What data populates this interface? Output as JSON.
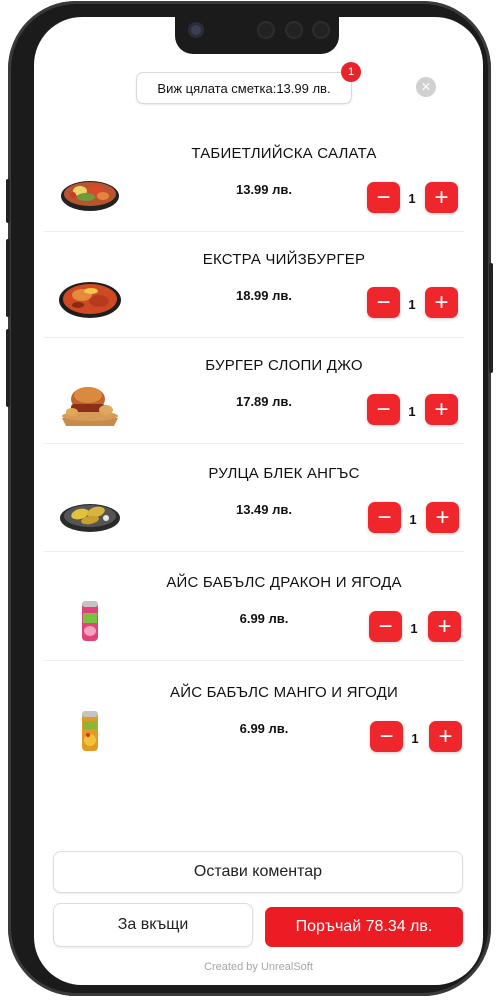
{
  "header": {
    "bill_label": "Виж цялата сметка:13.99 лв.",
    "bill_badge": "1",
    "close_icon": "close-icon"
  },
  "items": [
    {
      "name": "ТАБИЕТЛИЙСКА САЛАТА",
      "price": "13.99 лв.",
      "qty": "1",
      "thumb": "salad"
    },
    {
      "name": "ЕКСТРА ЧИЙЗБУРГЕР",
      "price": "18.99 лв.",
      "qty": "1",
      "thumb": "platter"
    },
    {
      "name": "БУРГЕР СЛОПИ ДЖО",
      "price": "17.89 лв.",
      "qty": "1",
      "thumb": "burger"
    },
    {
      "name": "РУЛЦА БЛЕК АНГЪС",
      "price": "13.49 лв.",
      "qty": "1",
      "thumb": "rolls"
    },
    {
      "name": "АЙС БАБЪЛС ДРАКОН И ЯГОДА",
      "price": "6.99 лв.",
      "qty": "1",
      "thumb": "drink-pink"
    },
    {
      "name": "АЙС БАБЪЛС МАНГО И ЯГОДИ",
      "price": "6.99 лв.",
      "qty": "1",
      "thumb": "drink-mango"
    }
  ],
  "controls": {
    "minus_label": "−",
    "plus_label": "+"
  },
  "footer": {
    "comment_label": "Остави коментар",
    "home_label": "За вкъщи",
    "order_label": "Поръчай 78.34 лв.",
    "credit": "Created by UnrealSoft"
  },
  "colors": {
    "accent": "#ec1c24",
    "device": "#1b1b1b"
  }
}
